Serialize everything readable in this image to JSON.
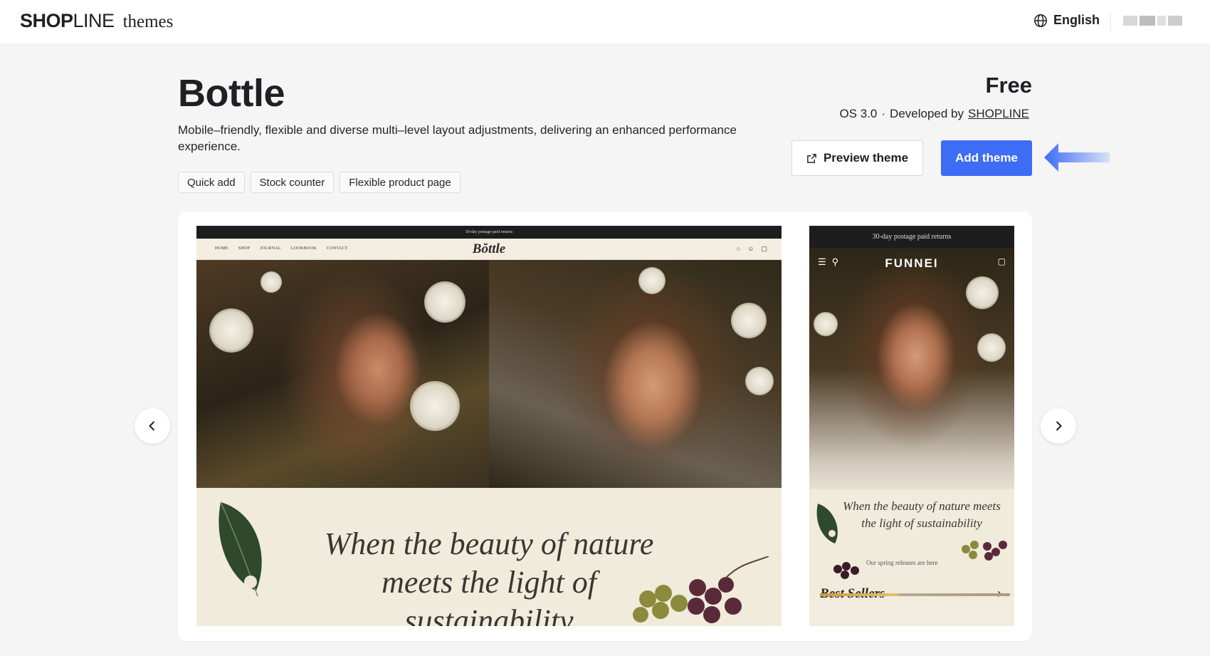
{
  "topbar": {
    "brand": "SHOPLINE",
    "brand_bold": "SHOP",
    "brand_light": "LINE",
    "brand_suffix": "themes",
    "language": "English",
    "language_icon": "globe-icon"
  },
  "theme": {
    "name": "Bottle",
    "description": "Mobile–friendly, flexible and diverse multi–level layout adjustments, delivering an enhanced performance experience.",
    "tags": [
      "Quick add",
      "Stock counter",
      "Flexible product page"
    ],
    "price": "Free",
    "os_version": "OS 3.0",
    "separator": "·",
    "developed_by_label": "Developed by",
    "developer": "SHOPLINE"
  },
  "actions": {
    "preview_label": "Preview theme",
    "preview_icon": "external-link-icon",
    "add_label": "Add theme",
    "accent_color": "#3d6cf5"
  },
  "gallery": {
    "desktop": {
      "announcement": "30-day postage paid returns",
      "menu": [
        "HOME",
        "SHOP",
        "JOURNAL",
        "LOOKBOOK",
        "CONTACT"
      ],
      "logo": "Bŏttle",
      "icons": [
        "search-icon",
        "account-icon",
        "cart-icon"
      ],
      "tagline_lines": [
        "When the beauty of nature",
        "meets the light of",
        "sustainability"
      ]
    },
    "mobile": {
      "announcement": "30-day postage paid returns",
      "logo": "FUNNEI",
      "tagline": "When the beauty of nature meets the light of sustainability",
      "subline": "Our spring releases are here",
      "best_sellers": "Best Sellers"
    },
    "prev_icon": "chevron-left-icon",
    "next_icon": "chevron-right-icon"
  }
}
